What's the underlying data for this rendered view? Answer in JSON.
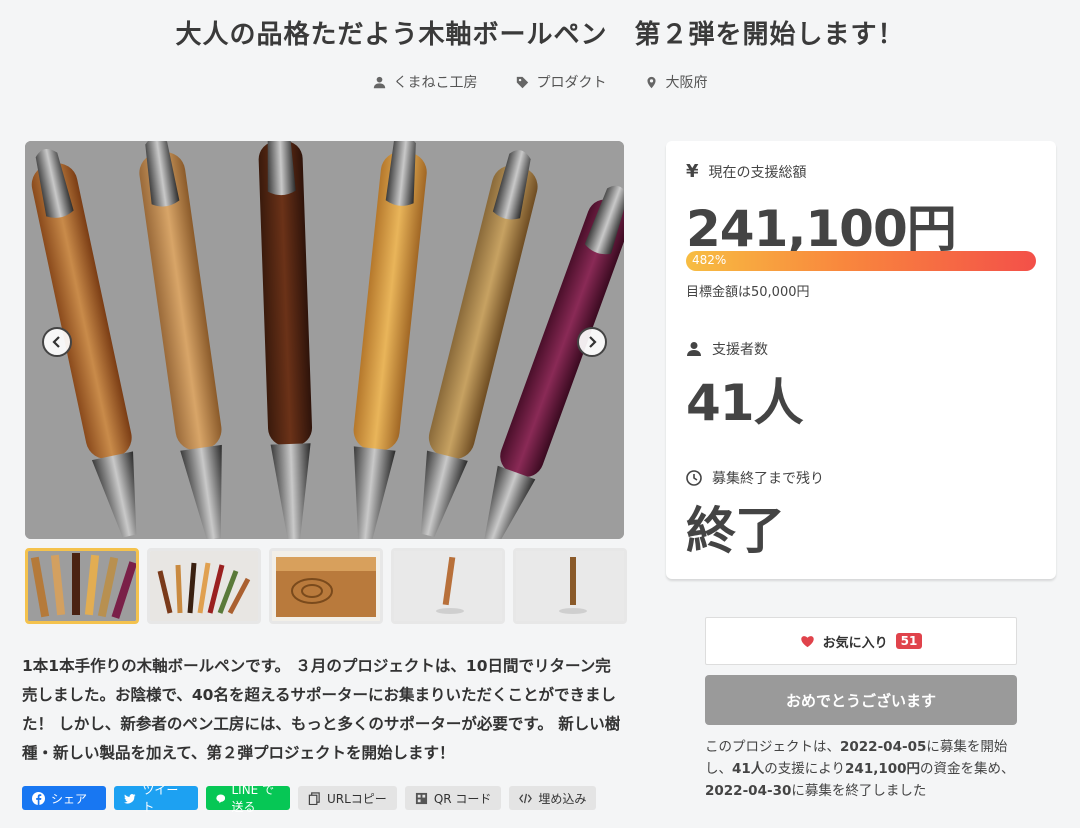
{
  "page": {
    "title": "大人の品格ただよう木軸ボールペン　第２弾を開始します！",
    "meta": {
      "author": "くまねこ工房",
      "category": "プロダクト",
      "location": "大阪府"
    }
  },
  "stats": {
    "amount_label": "現在の支援総額",
    "amount": "241,100円",
    "progress_text": "482%",
    "progress_percent": 482,
    "goal_text": "目標金額は50,000円",
    "supporters_label": "支援者数",
    "supporters": "41人",
    "remaining_label": "募集終了まで残り",
    "remaining": "終了",
    "yen_symbol": "¥"
  },
  "favorite": {
    "label": "お気に入り",
    "count": "51"
  },
  "congrats_label": "おめでとうございます",
  "summary": {
    "p1": "このプロジェクトは、",
    "start_date": "2022-04-05",
    "p2": "に募集を開始し、",
    "supporters": "41人",
    "p3": "の支援により",
    "amount": "241,100円",
    "p4": "の資金を集め、",
    "end_date": "2022-04-30",
    "p5": "に募集を終了しました"
  },
  "description": "1本1本手作りの木軸ボールペンです。 ３月のプロジェクトは、10日間でリターン完売しました。お陰様で、40名を超えるサポーターにお集まりいただくことができました！ しかし、新参者のペン工房には、もっと多くのサポーターが必要です。 新しい樹種・新しい製品を加えて、第２弾プロジェクトを開始します！",
  "share": {
    "facebook": "シェア",
    "twitter": "ツイート",
    "line": "LINE で送る",
    "url_copy": "URLコピー",
    "qr": "QR コード",
    "embed": "埋め込み"
  },
  "icons": [
    "user-icon",
    "tag-icon",
    "map-pin-icon",
    "yen-icon",
    "clock-icon",
    "heart-icon",
    "chevron-left-icon",
    "chevron-right-icon"
  ],
  "colors": {
    "progress_start": "#f7bd42",
    "progress_end": "#f35049",
    "badge": "#e0434b",
    "thumb_active": "#f4c24d"
  }
}
